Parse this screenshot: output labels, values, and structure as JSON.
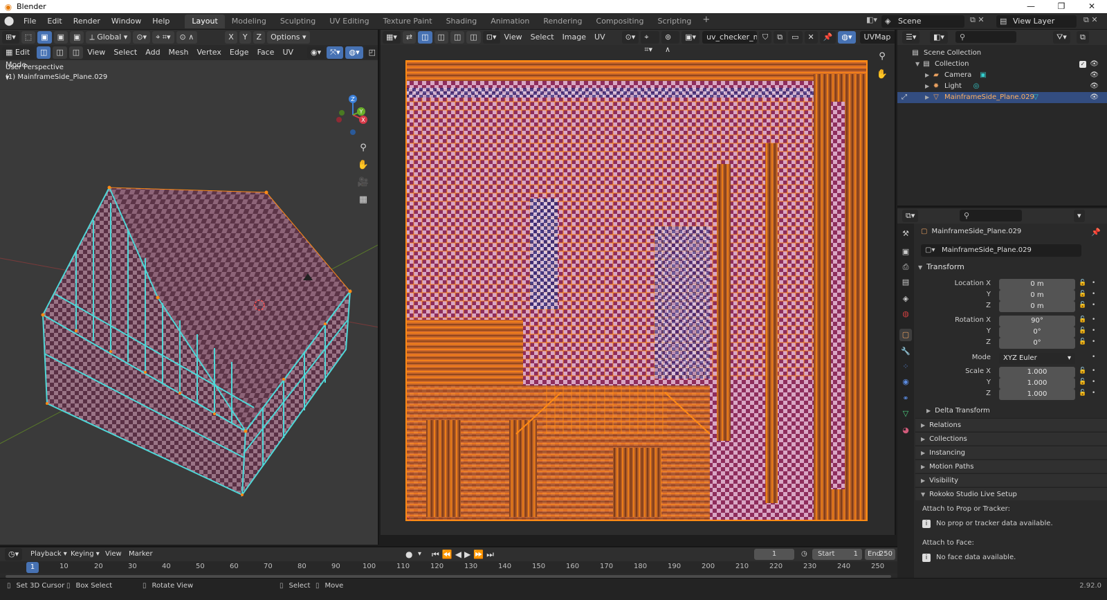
{
  "window": {
    "title": "Blender",
    "controls": [
      "—",
      "❐",
      "✕"
    ]
  },
  "topbar": {
    "menus": [
      "File",
      "Edit",
      "Render",
      "Window",
      "Help"
    ],
    "workspaces": [
      "Layout",
      "Modeling",
      "Sculpting",
      "UV Editing",
      "Texture Paint",
      "Shading",
      "Animation",
      "Rendering",
      "Compositing",
      "Scripting"
    ],
    "active_workspace": "Layout",
    "add_workspace": "+",
    "scene": "Scene",
    "view_layer": "View Layer"
  },
  "viewport3d": {
    "orientation": "Global",
    "options_label": "Options",
    "axis_labels": [
      "X",
      "Y",
      "Z"
    ],
    "mode": "Edit Mode",
    "menus": [
      "View",
      "Select",
      "Add",
      "Mesh",
      "Vertex",
      "Edge",
      "Face",
      "UV"
    ],
    "info_line1": "User Perspective",
    "info_line2": "(1) MainframeSide_Plane.029",
    "gizmo_labels": {
      "x": "X",
      "y": "Y",
      "z": "Z"
    },
    "colors": {
      "roof": "#7a4a5e",
      "wire": "#4fd7d7",
      "vertex": "#ff8a14"
    }
  },
  "uv_editor": {
    "menus": [
      "View",
      "Select",
      "Image",
      "UV"
    ],
    "image_name": "uv_checker_map_cu...",
    "uv_map": "UVMap",
    "colors": {
      "checker_light": "#d9a6c4",
      "checker_dark": "#8e2d5c",
      "edges": "#ff8a14",
      "accent": "#2a2a7a"
    }
  },
  "outliner": {
    "root": "Scene Collection",
    "items": [
      {
        "label": "Collection",
        "icon": "collection-icon"
      },
      {
        "label": "Camera",
        "icon": "camera-icon"
      },
      {
        "label": "Light",
        "icon": "light-icon"
      },
      {
        "label": "MainframeSide_Plane.029",
        "icon": "mesh-icon",
        "selected": true
      }
    ]
  },
  "properties": {
    "object_name": "MainframeSide_Plane.029",
    "object_field": "MainframeSide_Plane.029",
    "transform_title": "Transform",
    "location_label": "Location X",
    "location": [
      "0 m",
      "0 m",
      "0 m"
    ],
    "rotation_label": "Rotation X",
    "rotation": [
      "90°",
      "0°",
      "0°"
    ],
    "mode_label": "Mode",
    "mode_value": "XYZ Euler",
    "scale_label": "Scale X",
    "scale": [
      "1.000",
      "1.000",
      "1.000"
    ],
    "axis_y": "Y",
    "axis_z": "Z",
    "delta_transform": "Delta Transform",
    "panels": [
      "Relations",
      "Collections",
      "Instancing",
      "Motion Paths",
      "Visibility"
    ],
    "rokoko_title": "Rokoko Studio Live Setup",
    "attach_prop_label": "Attach to Prop or Tracker:",
    "attach_prop_info": "No prop or tracker data available.",
    "attach_face_label": "Attach to Face:",
    "attach_face_info": "No face data available."
  },
  "timeline": {
    "menus": [
      "Playback",
      "Keying",
      "View",
      "Marker"
    ],
    "current_frame": "1",
    "current_frame_field": "1",
    "start_label": "Start",
    "start_value": "1",
    "end_label": "End",
    "end_value": "250",
    "ruler": [
      "10",
      "20",
      "30",
      "40",
      "50",
      "60",
      "70",
      "80",
      "90",
      "100",
      "110",
      "120",
      "130",
      "140",
      "150",
      "160",
      "170",
      "180",
      "190",
      "200",
      "210",
      "220",
      "230",
      "240",
      "250"
    ]
  },
  "statusbar": {
    "items": [
      "Set 3D Cursor",
      "Box Select",
      "Rotate View",
      "Select",
      "Move"
    ],
    "version": "2.92.0"
  }
}
